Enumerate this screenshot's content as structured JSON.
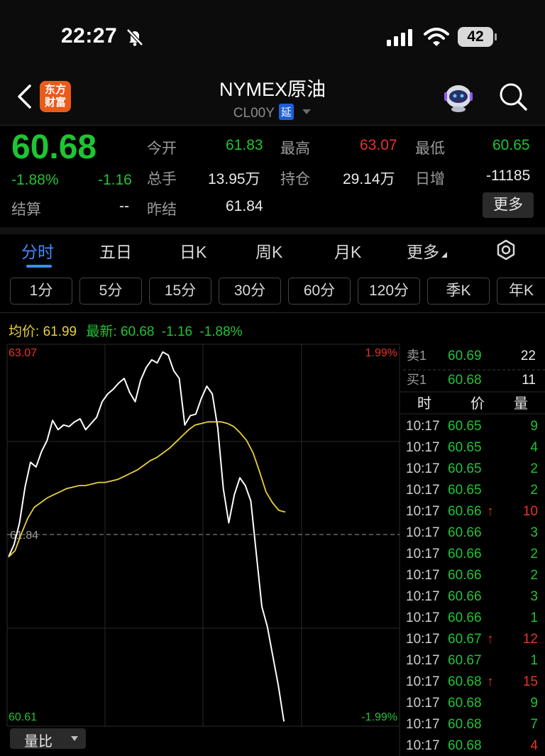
{
  "status_bar": {
    "time": "22:27",
    "battery": "42"
  },
  "header": {
    "title": "NYMEX原油",
    "code": "CL00Y",
    "delay_badge": "延",
    "logo_text": "东方\n财富"
  },
  "quote": {
    "price": "60.68",
    "change_pct": "-1.88%",
    "change": "-1.16",
    "settle_label": "结算",
    "settle_value": "--",
    "open_label": "今开",
    "open_value": "61.83",
    "high_label": "最高",
    "high_value": "63.07",
    "low_label": "最低",
    "low_value": "60.65",
    "volume_label": "总手",
    "volume_value": "13.95万",
    "oi_label": "持仓",
    "oi_value": "29.14万",
    "daily_inc_label": "日增",
    "daily_inc_value": "-11185",
    "prev_settle_label": "昨结",
    "prev_settle_value": "61.84",
    "more_button": "更多"
  },
  "tabs": [
    "分时",
    "五日",
    "日K",
    "周K",
    "月K",
    "更多"
  ],
  "periods": [
    "1分",
    "5分",
    "15分",
    "30分",
    "60分",
    "120分",
    "季K",
    "年K"
  ],
  "legend": {
    "avg_label": "均价:",
    "avg_value": "61.99",
    "last_label": "最新:",
    "last_value": "60.68",
    "last_change": "-1.16",
    "last_pct": "-1.88%"
  },
  "chart_data": {
    "type": "line",
    "axis": {
      "top_price": "63.07",
      "bottom_price": "60.61",
      "mid_price": "61.84",
      "top_pct": "1.99%",
      "bottom_pct": "-1.99%"
    },
    "ylim": [
      60.61,
      63.07
    ],
    "series": [
      {
        "role": "price",
        "values": [
          61.7,
          61.78,
          61.92,
          62.15,
          62.31,
          62.28,
          62.38,
          62.45,
          62.58,
          62.52,
          62.55,
          62.54,
          62.57,
          62.59,
          62.52,
          62.56,
          62.6,
          62.7,
          62.75,
          62.78,
          62.82,
          62.85,
          62.76,
          62.7,
          62.84,
          62.92,
          62.97,
          62.95,
          63.02,
          63.0,
          62.9,
          62.85,
          62.55,
          62.61,
          62.62,
          62.72,
          62.8,
          62.75,
          62.53,
          62.14,
          61.92,
          62.1,
          62.21,
          62.16,
          62.06,
          61.72,
          61.38,
          61.25,
          61.06,
          60.87,
          60.64
        ]
      },
      {
        "role": "average",
        "values": [
          61.7,
          61.74,
          61.85,
          61.95,
          62.02,
          62.05,
          62.08,
          62.1,
          62.12,
          62.14,
          62.15,
          62.16,
          62.16,
          62.17,
          62.18,
          62.18,
          62.19,
          62.2,
          62.22,
          62.24,
          62.26,
          62.29,
          62.32,
          62.34,
          62.37,
          62.4,
          62.44,
          62.48,
          62.52,
          62.55,
          62.56,
          62.57,
          62.57,
          62.57,
          62.56,
          62.54,
          62.5,
          62.45,
          62.37,
          62.25,
          62.12,
          62.05,
          62.0,
          61.99
        ]
      }
    ]
  },
  "volume_ratio_label": "量比",
  "orderbook": {
    "ask_label": "卖1",
    "ask_price": "60.69",
    "ask_vol": "22",
    "bid_label": "买1",
    "bid_price": "60.68",
    "bid_vol": "11"
  },
  "ticks_header": {
    "time": "时",
    "price": "价",
    "vol": "量"
  },
  "ticks": [
    {
      "time": "10:17",
      "price": "60.65",
      "arrow": "",
      "vol": "9",
      "vol_color": "green"
    },
    {
      "time": "10:17",
      "price": "60.65",
      "arrow": "",
      "vol": "4",
      "vol_color": "green"
    },
    {
      "time": "10:17",
      "price": "60.65",
      "arrow": "",
      "vol": "2",
      "vol_color": "green"
    },
    {
      "time": "10:17",
      "price": "60.65",
      "arrow": "",
      "vol": "2",
      "vol_color": "green"
    },
    {
      "time": "10:17",
      "price": "60.66",
      "arrow": "↑",
      "vol": "10",
      "vol_color": "red"
    },
    {
      "time": "10:17",
      "price": "60.66",
      "arrow": "",
      "vol": "3",
      "vol_color": "green"
    },
    {
      "time": "10:17",
      "price": "60.66",
      "arrow": "",
      "vol": "2",
      "vol_color": "green"
    },
    {
      "time": "10:17",
      "price": "60.66",
      "arrow": "",
      "vol": "2",
      "vol_color": "green"
    },
    {
      "time": "10:17",
      "price": "60.66",
      "arrow": "",
      "vol": "3",
      "vol_color": "green"
    },
    {
      "time": "10:17",
      "price": "60.66",
      "arrow": "",
      "vol": "1",
      "vol_color": "green"
    },
    {
      "time": "10:17",
      "price": "60.67",
      "arrow": "↑",
      "vol": "12",
      "vol_color": "red"
    },
    {
      "time": "10:17",
      "price": "60.67",
      "arrow": "",
      "vol": "1",
      "vol_color": "green"
    },
    {
      "time": "10:17",
      "price": "60.68",
      "arrow": "↑",
      "vol": "15",
      "vol_color": "red"
    },
    {
      "time": "10:17",
      "price": "60.68",
      "arrow": "",
      "vol": "9",
      "vol_color": "green"
    },
    {
      "time": "10:17",
      "price": "60.68",
      "arrow": "",
      "vol": "7",
      "vol_color": "green"
    },
    {
      "time": "10:17",
      "price": "60.68",
      "arrow": "",
      "vol": "4",
      "vol_color": "red"
    }
  ],
  "colors": {
    "up": "#e8322c",
    "down": "#1fc434",
    "accent": "#3b8cff",
    "avg_line": "#e8d13a"
  },
  "icons": [
    "back-icon",
    "bell-slash-icon",
    "signal-icon",
    "wifi-icon",
    "robot-avatar-icon",
    "search-icon",
    "dropdown-caret-icon",
    "gear-icon"
  ]
}
